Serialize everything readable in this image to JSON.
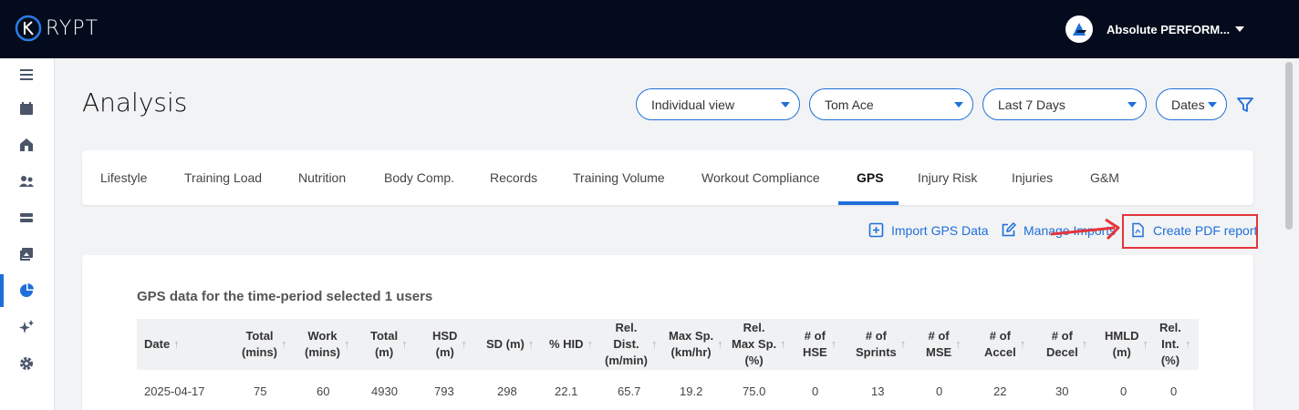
{
  "app": {
    "brand": "RYPT"
  },
  "org": {
    "name": "Absolute PERFORM..."
  },
  "page": {
    "title": "Analysis"
  },
  "filters": {
    "view": "Individual view",
    "athlete": "Tom Ace",
    "period": "Last 7 Days",
    "dates": "Dates"
  },
  "tabs": [
    "Lifestyle",
    "Training Load",
    "Nutrition",
    "Body Comp.",
    "Records",
    "Training Volume",
    "Workout Compliance",
    "GPS",
    "Injury Risk",
    "Injuries",
    "G&M"
  ],
  "active_tab": "GPS",
  "actions": {
    "import": "Import GPS Data",
    "manage": "Manage Imports",
    "pdf": "Create PDF report"
  },
  "table": {
    "title": "GPS data for the time-period selected 1 users",
    "headers": [
      [
        "Date"
      ],
      [
        "Total",
        "(mins)"
      ],
      [
        "Work",
        "(mins)"
      ],
      [
        "Total",
        "(m)"
      ],
      [
        "HSD",
        "(m)"
      ],
      [
        "SD (m)"
      ],
      [
        "% HID"
      ],
      [
        "Rel.",
        "Dist.",
        "(m/min)"
      ],
      [
        "Max Sp.",
        "(km/hr)"
      ],
      [
        "Rel.",
        "Max Sp.",
        "(%)"
      ],
      [
        "# of",
        "HSE"
      ],
      [
        "# of",
        "Sprints"
      ],
      [
        "# of",
        "MSE"
      ],
      [
        "# of",
        "Accel"
      ],
      [
        "# of",
        "Decel"
      ],
      [
        "HMLD",
        "(m)"
      ],
      [
        "Rel.",
        "Int.",
        "(%)"
      ]
    ],
    "rows": [
      [
        "2025-04-17",
        "75",
        "60",
        "4930",
        "793",
        "298",
        "22.1",
        "65.7",
        "19.2",
        "75.0",
        "0",
        "13",
        "0",
        "22",
        "30",
        "0",
        "0"
      ]
    ]
  },
  "colors": {
    "accent": "#1e6fd9",
    "topbar": "#030b1c",
    "highlight": "#e5343b"
  }
}
